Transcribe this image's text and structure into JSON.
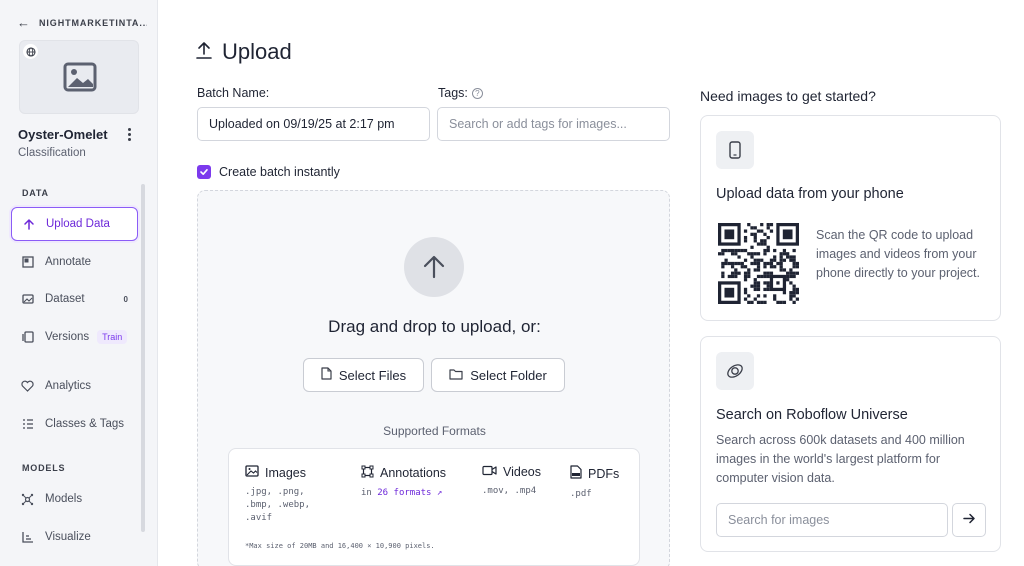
{
  "workspace": {
    "back_icon": "arrow-left-icon",
    "name": "NIGHTMARKETINTA..."
  },
  "project": {
    "name": "Oyster-Omelet",
    "type": "Classification"
  },
  "sidebar": {
    "data_section": "DATA",
    "models_section": "MODELS",
    "items": [
      {
        "label": "Upload Data",
        "icon": "upload-icon",
        "active": true
      },
      {
        "label": "Annotate",
        "icon": "annotate-icon"
      },
      {
        "label": "Dataset",
        "icon": "dataset-icon",
        "count": "0"
      },
      {
        "label": "Versions",
        "icon": "versions-icon",
        "badge": "Train"
      },
      {
        "label": "Analytics",
        "icon": "analytics-icon"
      },
      {
        "label": "Classes & Tags",
        "icon": "classes-icon"
      },
      {
        "label": "Models",
        "icon": "models-icon"
      },
      {
        "label": "Visualize",
        "icon": "visualize-icon"
      }
    ]
  },
  "page": {
    "title": "Upload"
  },
  "batch": {
    "label": "Batch Name:",
    "value": "Uploaded on 09/19/25 at 2:17 pm"
  },
  "tags": {
    "label": "Tags:",
    "placeholder": "Search or add tags for images..."
  },
  "create_batch": {
    "label": "Create batch instantly",
    "checked": true
  },
  "dropzone": {
    "title": "Drag and drop to upload, or:",
    "select_files": "Select Files",
    "select_folder": "Select Folder",
    "formats_label": "Supported Formats"
  },
  "formats": {
    "images": {
      "title": "Images",
      "line1": ".jpg, .png,",
      "line2": ".bmp, .webp,",
      "line3": ".avif"
    },
    "annotations": {
      "title": "Annotations",
      "prefix": "in",
      "link": "26 formats"
    },
    "videos": {
      "title": "Videos",
      "line1": ".mov, .mp4"
    },
    "pdfs": {
      "title": "PDFs",
      "line1": ".pdf"
    },
    "note": "*Max size of 20MB and 16,400 × 10,900 pixels."
  },
  "right": {
    "title": "Need images to get started?",
    "phone_card": {
      "title": "Upload data from your phone",
      "text": "Scan the QR code to upload images and videos from your phone directly to your project."
    },
    "universe_card": {
      "title": "Search on Roboflow Universe",
      "text": "Search across 600k datasets and 400 million images in the world's largest platform for computer vision data.",
      "search_placeholder": "Search for images"
    }
  },
  "colors": {
    "accent": "#7c3aed",
    "sidebar_bg": "#f4f5f8"
  }
}
